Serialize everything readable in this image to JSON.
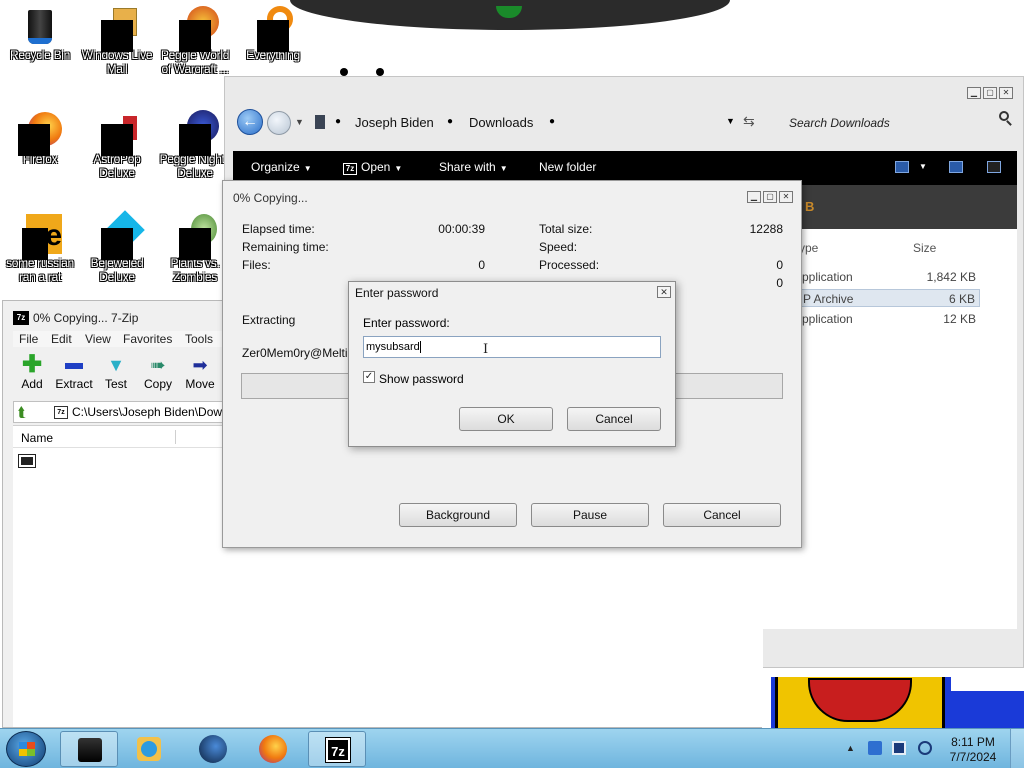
{
  "desktop": {
    "icons": [
      {
        "label": "Recycle Bin",
        "icon": "recycle-bin-icon"
      },
      {
        "label": "Windows Live\nMail",
        "icon": "mail-icon"
      },
      {
        "label": "Peggle World\nof Warcraft ...",
        "icon": "peggle-icon"
      },
      {
        "label": "Everything",
        "icon": "search-orange-icon"
      },
      {
        "label": "Firefox",
        "icon": "firefox-icon"
      },
      {
        "label": "AstroPop\nDeluxe",
        "icon": "astropop-icon"
      },
      {
        "label": "Peggle Nights\nDeluxe",
        "icon": "peggle-nights-icon"
      },
      {
        "label": "some russian\nran a rat",
        "icon": "custom-e-icon"
      },
      {
        "label": "Bejeweled\nDeluxe",
        "icon": "gem-icon"
      },
      {
        "label": "Plants vs.\nZombies",
        "icon": "plant-icon"
      }
    ]
  },
  "explorer": {
    "breadcrumb": [
      "Joseph Biden",
      "Downloads"
    ],
    "search_placeholder": "Search Downloads",
    "commands": {
      "organize": "Organize",
      "open": "Open",
      "share": "Share with",
      "new_folder": "New folder"
    },
    "banner_text": "B",
    "columns": {
      "type": "ype",
      "size": "Size"
    },
    "rows": [
      {
        "type": "pplication",
        "size": "1,842 KB"
      },
      {
        "type": "P Archive",
        "size": "6 KB"
      },
      {
        "type": "pplication",
        "size": "12 KB"
      }
    ]
  },
  "zip": {
    "title": "0% Copying... 7-Zip",
    "menu": [
      "File",
      "Edit",
      "View",
      "Favorites",
      "Tools"
    ],
    "toolbar": [
      {
        "label": "Add",
        "icon": "plus-icon",
        "color": "#2aa52a"
      },
      {
        "label": "Extract",
        "icon": "minus-icon",
        "color": "#1f3fc4"
      },
      {
        "label": "Test",
        "icon": "check-icon",
        "color": "#2ab0c8"
      },
      {
        "label": "Copy",
        "icon": "copy-arrow-icon",
        "color": "#2a8a6a"
      },
      {
        "label": "Move",
        "icon": "move-arrow-icon",
        "color": "#1f2f9a"
      }
    ],
    "path": "C:\\Users\\Joseph Biden\\Down",
    "list_header": "Name"
  },
  "progress": {
    "title": "0% Copying...",
    "elapsed_label": "Elapsed time:",
    "elapsed_value": "00:00:39",
    "remaining_label": "Remaining time:",
    "files_label": "Files:",
    "files_value": "0",
    "total_label": "Total size:",
    "total_value": "12288",
    "speed_label": "Speed:",
    "processed_label": "Processed:",
    "processed_value": "0",
    "hidden_value": "0",
    "action": "Extracting",
    "filename": "Zer0Mem0ry@Melting",
    "buttons": {
      "background": "Background",
      "pause": "Pause",
      "cancel": "Cancel"
    }
  },
  "password_dialog": {
    "title": "Enter password",
    "label": "Enter password:",
    "value": "mysubsard",
    "show_password_label": "Show password",
    "show_password_checked": true,
    "ok": "OK",
    "cancel": "Cancel"
  },
  "taskbar": {
    "time": "8:11 PM",
    "date": "7/7/2024",
    "pinned": [
      "explorer",
      "media-player",
      "steam",
      "firefox",
      "7-zip"
    ]
  }
}
